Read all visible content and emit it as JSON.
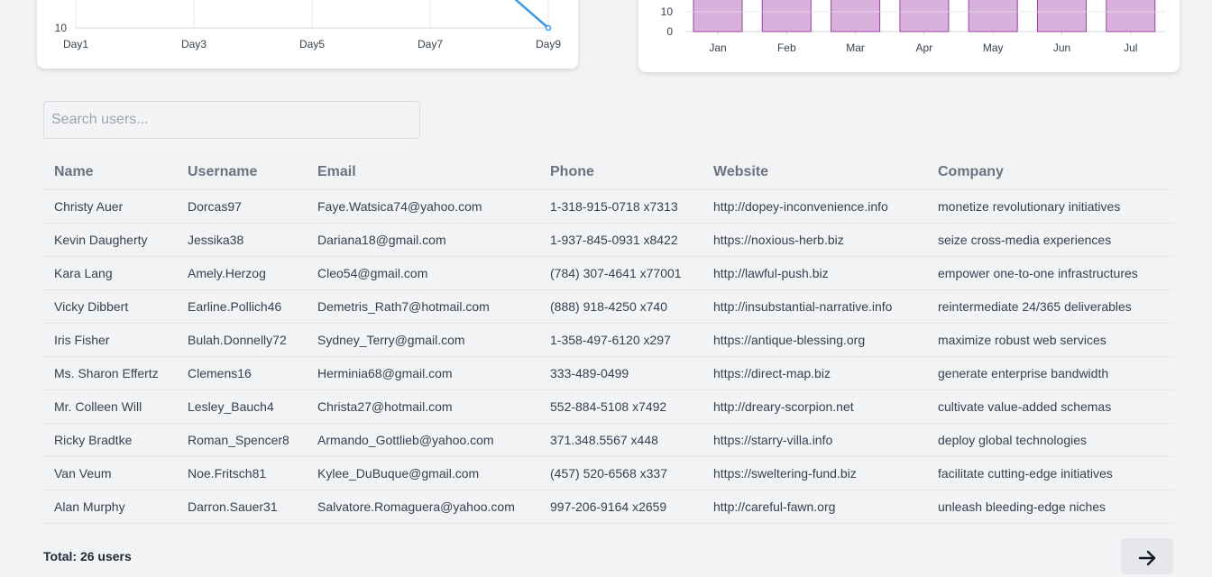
{
  "charts": {
    "line": {
      "x_ticks": [
        "Day1",
        "Day3",
        "Day5",
        "Day7",
        "Day9"
      ],
      "y_ticks_visible": [
        "10"
      ],
      "line_color": "#3b9ae8"
    },
    "bar": {
      "categories": [
        "Jan",
        "Feb",
        "Mar",
        "Apr",
        "May",
        "Jun",
        "Jul"
      ],
      "y_ticks_visible": [
        "10",
        "0"
      ],
      "bar_fill": "#d8b2dc",
      "bar_stroke": "#9b3fa3"
    }
  },
  "search": {
    "placeholder": "Search users..."
  },
  "table": {
    "headers": [
      "Name",
      "Username",
      "Email",
      "Phone",
      "Website",
      "Company"
    ],
    "rows": [
      [
        "Christy Auer",
        "Dorcas97",
        "Faye.Watsica74@yahoo.com",
        "1-318-915-0718 x7313",
        "http://dopey-inconvenience.info",
        "monetize revolutionary initiatives"
      ],
      [
        "Kevin Daugherty",
        "Jessika38",
        "Dariana18@gmail.com",
        "1-937-845-0931 x8422",
        "https://noxious-herb.biz",
        "seize cross-media experiences"
      ],
      [
        "Kara Lang",
        "Amely.Herzog",
        "Cleo54@gmail.com",
        "(784) 307-4641 x77001",
        "http://lawful-push.biz",
        "empower one-to-one infrastructures"
      ],
      [
        "Vicky Dibbert",
        "Earline.Pollich46",
        "Demetris_Rath7@hotmail.com",
        "(888) 918-4250 x740",
        "http://insubstantial-narrative.info",
        "reintermediate 24/365 deliverables"
      ],
      [
        "Iris Fisher",
        "Bulah.Donnelly72",
        "Sydney_Terry@gmail.com",
        "1-358-497-6120 x297",
        "https://antique-blessing.org",
        "maximize robust web services"
      ],
      [
        "Ms. Sharon Effertz",
        "Clemens16",
        "Herminia68@gmail.com",
        "333-489-0499",
        "https://direct-map.biz",
        "generate enterprise bandwidth"
      ],
      [
        "Mr. Colleen Will",
        "Lesley_Bauch4",
        "Christa27@hotmail.com",
        "552-884-5108 x7492",
        "http://dreary-scorpion.net",
        "cultivate value-added schemas"
      ],
      [
        "Ricky Bradtke",
        "Roman_Spencer8",
        "Armando_Gottlieb@yahoo.com",
        "371.348.5567 x448",
        "https://starry-villa.info",
        "deploy global technologies"
      ],
      [
        "Van Veum",
        "Noe.Fritsch81",
        "Kylee_DuBuque@gmail.com",
        "(457) 520-6568 x337",
        "https://sweltering-fund.biz",
        "facilitate cutting-edge initiatives"
      ],
      [
        "Alan Murphy",
        "Darron.Sauer31",
        "Salvatore.Romaguera@yahoo.com",
        "997-206-9164 x2659",
        "http://careful-fawn.org",
        "unleash bleeding-edge niches"
      ]
    ]
  },
  "footer": {
    "total_label": "Total: 26 users",
    "next_icon": "arrow-right-icon"
  }
}
